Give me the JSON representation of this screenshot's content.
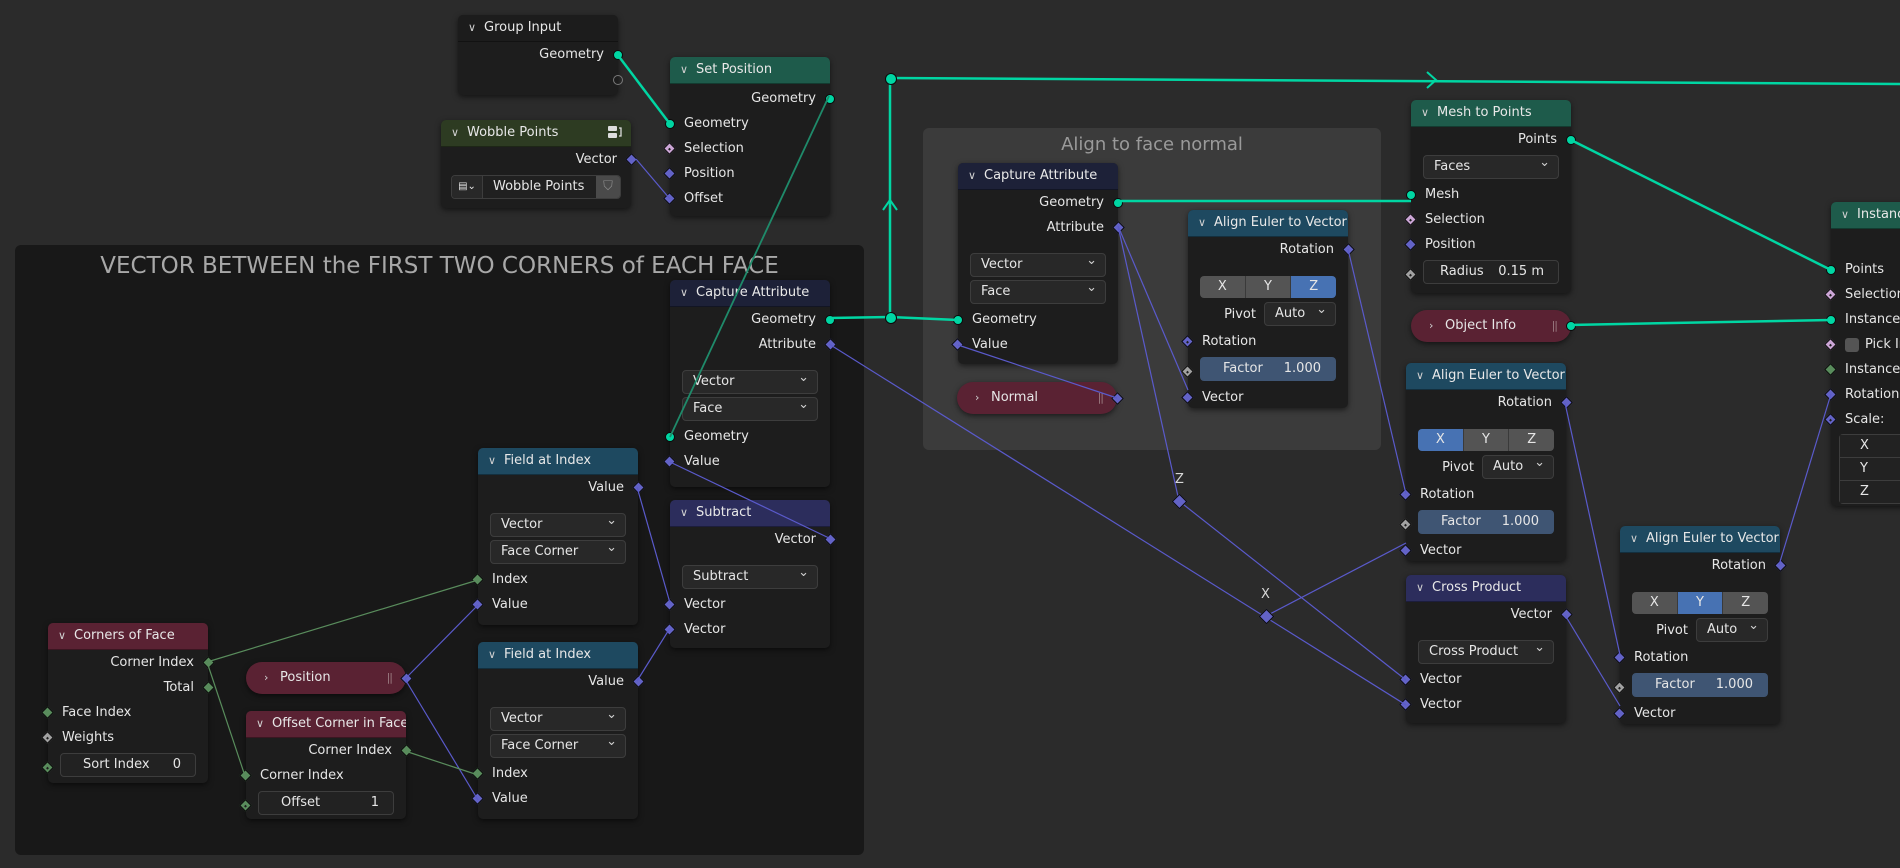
{
  "editor": "Geometry Node Editor",
  "colors": {
    "background": "#2b2b2b",
    "geometry_socket": "#00d6a3",
    "vector_socket": "#6363c7",
    "integer_socket": "#598c5c",
    "boolean_socket": "#cca6d6",
    "float_socket": "#a1a1a1",
    "selected_toggle": "#4772b3"
  },
  "frames": {
    "vector_between": {
      "title": "VECTOR BETWEEN the FIRST TWO CORNERS of EACH FACE"
    },
    "align_face_normal": {
      "title": "Align to face normal"
    }
  },
  "nodes": {
    "group_input": {
      "title": "Group Input",
      "outputs": [
        "Geometry"
      ]
    },
    "wobble_points": {
      "title": "Wobble Points",
      "outputs": [
        "Vector"
      ],
      "group_name": "Wobble Points"
    },
    "set_position": {
      "title": "Set Position",
      "outputs": [
        "Geometry"
      ],
      "inputs": [
        "Geometry",
        "Selection",
        "Position",
        "Offset"
      ]
    },
    "capture_attribute_1": {
      "title": "Capture Attribute",
      "outputs": [
        "Geometry",
        "Attribute"
      ],
      "data_type": "Vector",
      "domain": "Face",
      "inputs": [
        "Geometry",
        "Value"
      ]
    },
    "field_at_index_1": {
      "title": "Field at Index",
      "outputs": [
        "Value"
      ],
      "data_type": "Vector",
      "domain": "Face Corner",
      "inputs": [
        "Index",
        "Value"
      ]
    },
    "subtract": {
      "title": "Subtract",
      "outputs": [
        "Vector"
      ],
      "operation": "Subtract",
      "inputs": [
        "Vector",
        "Vector"
      ]
    },
    "field_at_index_2": {
      "title": "Field at Index",
      "outputs": [
        "Value"
      ],
      "data_type": "Vector",
      "domain": "Face Corner",
      "inputs": [
        "Index",
        "Value"
      ]
    },
    "corners_of_face": {
      "title": "Corners of Face",
      "outputs": [
        "Corner Index",
        "Total"
      ],
      "inputs": [
        "Face Index",
        "Weights"
      ],
      "sort_index_label": "Sort Index",
      "sort_index_value": "0"
    },
    "position": {
      "title": "Position"
    },
    "offset_corner": {
      "title": "Offset Corner in Face",
      "outputs": [
        "Corner Index"
      ],
      "inputs": [
        "Corner Index"
      ],
      "offset_label": "Offset",
      "offset_value": "1"
    },
    "capture_attribute_2": {
      "title": "Capture Attribute",
      "outputs": [
        "Geometry",
        "Attribute"
      ],
      "data_type": "Vector",
      "domain": "Face",
      "inputs": [
        "Geometry",
        "Value"
      ]
    },
    "normal": {
      "title": "Normal"
    },
    "align_euler_1": {
      "title": "Align Euler to Vector",
      "outputs": [
        "Rotation"
      ],
      "axis": [
        "X",
        "Y",
        "Z"
      ],
      "axis_selected": "Z",
      "pivot_label": "Pivot",
      "pivot_value": "Auto",
      "inputs": [
        "Rotation",
        "Vector"
      ],
      "factor_label": "Factor",
      "factor_value": "1.000"
    },
    "mesh_to_points": {
      "title": "Mesh to Points",
      "outputs": [
        "Points"
      ],
      "mode": "Faces",
      "inputs": [
        "Mesh",
        "Selection",
        "Position"
      ],
      "radius_label": "Radius",
      "radius_value": "0.15 m"
    },
    "object_info": {
      "title": "Object Info"
    },
    "align_euler_2": {
      "title": "Align Euler to Vector",
      "outputs": [
        "Rotation"
      ],
      "axis": [
        "X",
        "Y",
        "Z"
      ],
      "axis_selected": "X",
      "pivot_label": "Pivot",
      "pivot_value": "Auto",
      "inputs": [
        "Rotation",
        "Vector"
      ],
      "factor_label": "Factor",
      "factor_value": "1.000"
    },
    "cross_product": {
      "title": "Cross Product",
      "outputs": [
        "Vector"
      ],
      "operation": "Cross Product",
      "inputs": [
        "Vector",
        "Vector"
      ]
    },
    "align_euler_3": {
      "title": "Align Euler to Vector",
      "outputs": [
        "Rotation"
      ],
      "axis": [
        "X",
        "Y",
        "Z"
      ],
      "axis_selected": "Y",
      "pivot_label": "Pivot",
      "pivot_value": "Auto",
      "inputs": [
        "Rotation",
        "Vector"
      ],
      "factor_label": "Factor",
      "factor_value": "1.000"
    },
    "instance_on_points": {
      "title": "Instanc",
      "inputs": [
        "Points",
        "Selection",
        "Instance",
        "Pick In",
        "Instance I",
        "Rotation",
        "Scale:"
      ],
      "scale_axes": [
        "X",
        "Y",
        "Z"
      ]
    }
  },
  "reroutes": {
    "z_label": "Z",
    "x_label": "X"
  }
}
